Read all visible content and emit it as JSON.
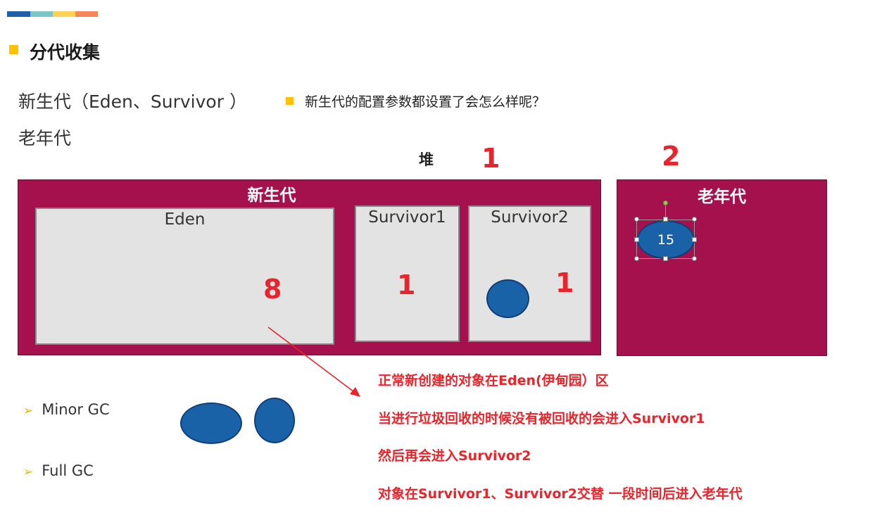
{
  "header": {
    "accent_colors": [
      "#1f5ea8",
      "#7cc7c5",
      "#ffd154",
      "#f5875a"
    ],
    "title": "分代收集"
  },
  "lines": {
    "young_gen": "新生代（Eden、Survivor ）",
    "old_gen": "老年代",
    "question": "新生代的配置参数都设置了会怎么样呢？"
  },
  "diagram": {
    "heap_label": "堆",
    "young_ratio": "1",
    "old_ratio": "2",
    "young_label": "新生代",
    "old_label": "老年代",
    "eden_label": "Eden",
    "survivor1_label": "Survivor1",
    "survivor2_label": "Survivor2",
    "eden_ratio": "8",
    "survivor1_ratio": "1",
    "survivor2_ratio": "1",
    "old_object_age": "15",
    "region_color": "#a4114d",
    "object_color": "#1a62a8",
    "annotation_color": "#e8242c"
  },
  "gc": {
    "items": [
      {
        "marker": "➢",
        "label": "Minor GC"
      },
      {
        "marker": "➢",
        "label": "Full GC"
      }
    ]
  },
  "notes": [
    "正常新创建的对象在Eden(伊甸园）区",
    "当进行垃圾回收的时候没有被回收的会进入Survivor1",
    "然后再会进入Survivor2",
    "对象在Survivor1、Survivor2交替 一段时间后进入老年代"
  ]
}
